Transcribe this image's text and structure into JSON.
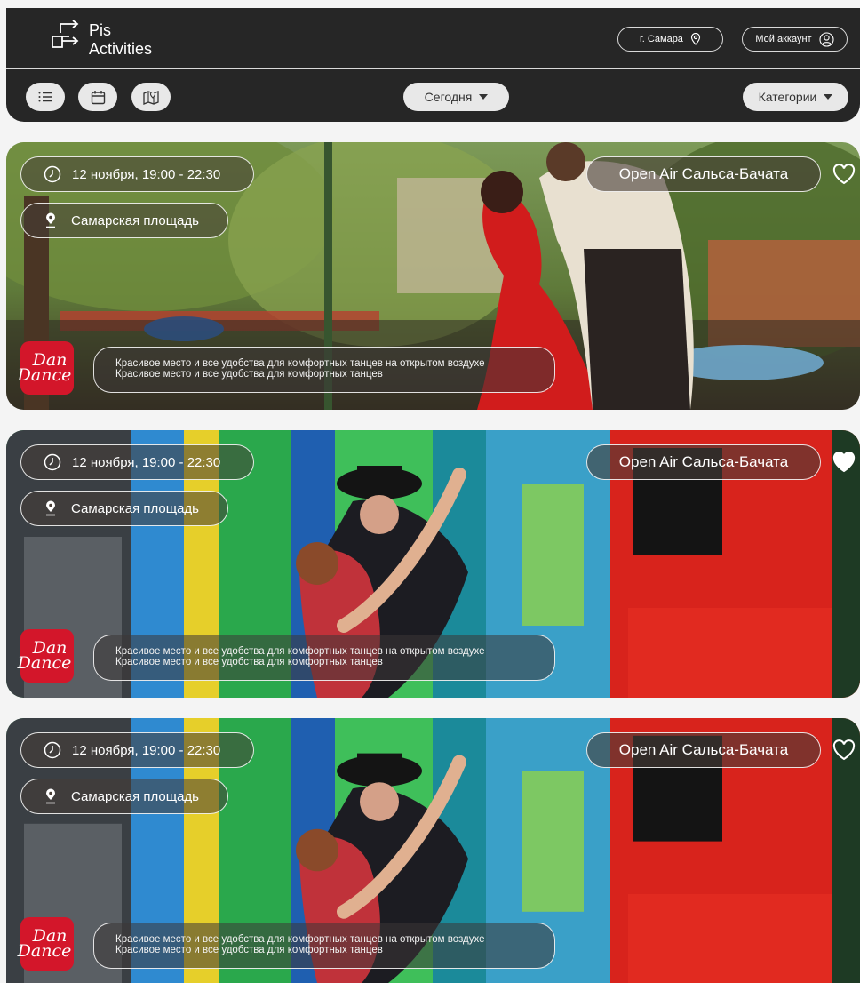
{
  "app": {
    "logo_line1": "Pis",
    "logo_line2": "Activities"
  },
  "header": {
    "city_label": "г. Самара",
    "account_label": "Мой аккаунт",
    "date_filter": "Сегодня",
    "category_filter": "Категории",
    "view_buttons": [
      "list-icon",
      "calendar-icon",
      "map-icon"
    ]
  },
  "events": [
    {
      "datetime": "12 ноября, 19:00 - 22:30",
      "place": "Самарская площадь",
      "title": "Open Air Сальса-Бачата",
      "favorite": false,
      "organizer_line1": "Dan",
      "organizer_line2": "Dance",
      "description_line1": "Красивое место и все удобства для комфортных танцев на открытом воздухе",
      "description_line2": "Красивое место и все удобства для комфортных танцев"
    },
    {
      "datetime": "12 ноября, 19:00 - 22:30",
      "place": "Самарская площадь",
      "title": "Open Air Сальса-Бачата",
      "favorite": true,
      "organizer_line1": "Dan",
      "organizer_line2": "Dance",
      "description_line1": "Красивое место и все удобства для комфортных танцев на открытом воздухе",
      "description_line2": "Красивое место и все удобства для комфортных танцев"
    },
    {
      "datetime": "12 ноября, 19:00 - 22:30",
      "place": "Самарская площадь",
      "title": "Open Air Сальса-Бачата",
      "favorite": false,
      "organizer_line1": "Dan",
      "organizer_line2": "Dance",
      "description_line1": "Красивое место и все удобства для комфортных танцев на открытом воздухе",
      "description_line2": "Красивое место и все удобства для комфортных танцев"
    }
  ],
  "colors": {
    "header_bg": "#262626",
    "page_bg": "#f4f4f4",
    "brand_red": "#d3162a",
    "pill_bg": "#e8e8e8"
  }
}
